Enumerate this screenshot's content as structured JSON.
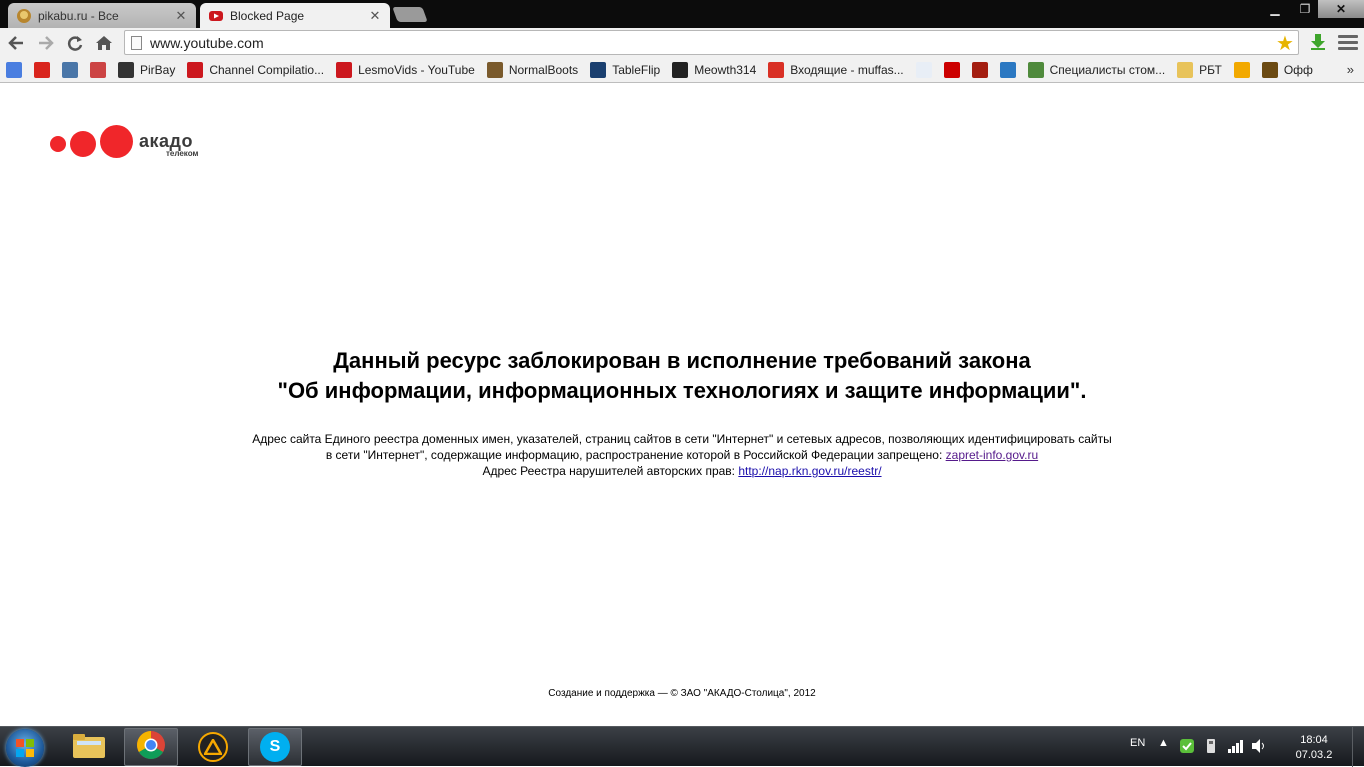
{
  "browser": {
    "tabs": [
      {
        "label": "pikabu.ru - Все",
        "active": false
      },
      {
        "label": "Blocked Page",
        "active": true
      }
    ],
    "address_bar": {
      "url": "www.youtube.com"
    },
    "bookmarks": [
      {
        "label": "",
        "icon": "google-icon",
        "color": "#4a7ee0"
      },
      {
        "label": "",
        "icon": "ussr-icon",
        "color": "#d9251d"
      },
      {
        "label": "",
        "icon": "vk-icon",
        "color": "#4a76a8"
      },
      {
        "label": "",
        "icon": "flower-icon",
        "color": "#c44"
      },
      {
        "label": "PirBay",
        "icon": "pirate-ship-icon",
        "color": "#333"
      },
      {
        "label": "Channel Compilatio...",
        "icon": "youtube-icon",
        "color": "#cc181e"
      },
      {
        "label": "LesmoVids - YouTube",
        "icon": "youtube-icon",
        "color": "#cc181e"
      },
      {
        "label": "NormalBoots",
        "icon": "boots-icon",
        "color": "#7a5a2c"
      },
      {
        "label": "TableFlip",
        "icon": "tableflip-icon",
        "color": "#1a3f6f"
      },
      {
        "label": "Meowth314",
        "icon": "steam-icon",
        "color": "#222"
      },
      {
        "label": "Входящие - muffas...",
        "icon": "gmail-icon",
        "color": "#d93025"
      },
      {
        "label": "",
        "icon": "tile-icon",
        "color": "#e8eef6"
      },
      {
        "label": "",
        "icon": "c-logo-icon",
        "color": "#c00"
      },
      {
        "label": "",
        "icon": "red-square-icon",
        "color": "#a31d10"
      },
      {
        "label": "",
        "icon": "circle-logo-icon",
        "color": "#2b78c2"
      },
      {
        "label": "Специалисты стом...",
        "icon": "dental-icon",
        "color": "#4f8a3c"
      },
      {
        "label": "РБТ",
        "icon": "folder-icon",
        "color": "#e8c35a"
      },
      {
        "label": "",
        "icon": "puzzle-icon",
        "color": "#f2a900"
      },
      {
        "label": "Офф",
        "icon": "wow-icon",
        "color": "#6b4a12"
      }
    ]
  },
  "page": {
    "logo": {
      "wordmark": "акадо",
      "subtitle": "телеком"
    },
    "headline_line1": "Данный ресурс заблокирован в исполнение требований закона",
    "headline_line2": "\"Об информации, информационных технологиях и защите информации\".",
    "info_line1": "Адрес сайта Единого реестра доменных имен, указателей, страниц сайтов в сети \"Интернет\" и сетевых адресов, позволяющих идентифицировать сайты",
    "info_line2_text": "в сети \"Интернет\", содержащие информацию, распространение которой в Российской Федерации запрещено: ",
    "info_line2_link": "zapret-info.gov.ru",
    "info_line3_text": "Адрес Реестра нарушителей авторских прав: ",
    "info_line3_link": "http://nap.rkn.gov.ru/reestr/",
    "footer": "Создание и поддержка — © ЗАО \"АКАДО-Столица\", 2012"
  },
  "taskbar": {
    "language": "EN",
    "time": "18:04",
    "date": "07.03.2"
  }
}
